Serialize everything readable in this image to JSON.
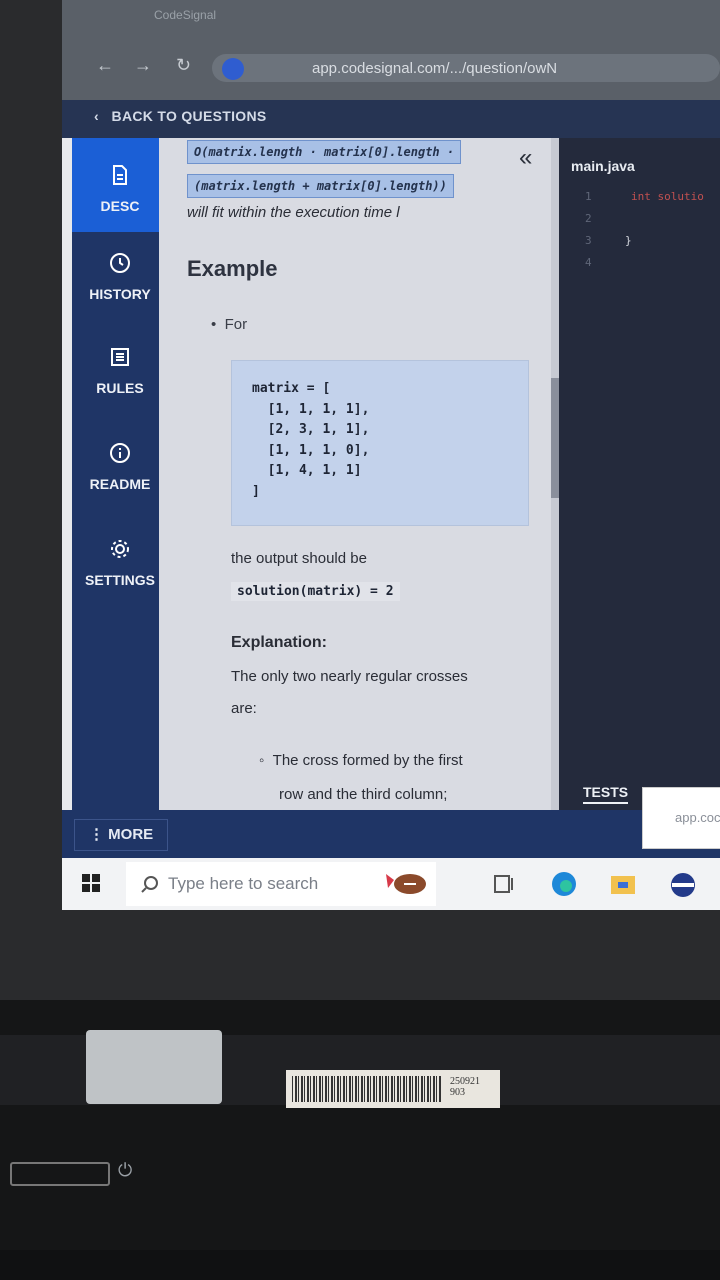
{
  "browser": {
    "tab_title": "CodeSignal",
    "url": "app.codesignal.com/.../question/owN"
  },
  "header": {
    "back_label": "BACK TO QUESTIONS"
  },
  "sidebar": {
    "items": [
      {
        "label": "DESC",
        "icon": "document-icon",
        "active": true
      },
      {
        "label": "HISTORY",
        "icon": "clock-icon"
      },
      {
        "label": "RULES",
        "icon": "list-icon"
      },
      {
        "label": "README",
        "icon": "info-icon"
      },
      {
        "label": "SETTINGS",
        "icon": "gear-icon"
      }
    ],
    "more_label": "MORE"
  },
  "description": {
    "complexity_line1": "O(matrix.length · matrix[0].length ·",
    "complexity_line2": "(matrix.length + matrix[0].length))",
    "fit_text": "will fit within the execution time l",
    "example_heading": "Example",
    "for_label": "For",
    "matrix_code": "matrix = [\n  [1, 1, 1, 1],\n  [2, 3, 1, 1],\n  [1, 1, 1, 0],\n  [1, 4, 1, 1]\n]",
    "output_text": "the output should be",
    "solution_code": "solution(matrix) = 2",
    "explanation_heading": "Explanation:",
    "explanation_line1": "The only two nearly regular crosses",
    "explanation_line2": "are:",
    "sub_bullet_line1": "The cross formed by the first",
    "sub_bullet_line2": "row and the third column;"
  },
  "editor": {
    "filename": "main.java",
    "line_numbers": [
      "1",
      "2",
      "3",
      "4"
    ],
    "code_line1": "int solutio",
    "code_line3": "}",
    "tests_label": "TESTS"
  },
  "popup": {
    "text": "app.coc"
  },
  "taskbar": {
    "search_placeholder": "Type here to search"
  },
  "sticker": {
    "line1": "250921",
    "line2": "903"
  },
  "colors": {
    "accent": "#1b5fd6",
    "sidebar_bg": "#1f3566",
    "editor_bg": "#242a3c"
  }
}
